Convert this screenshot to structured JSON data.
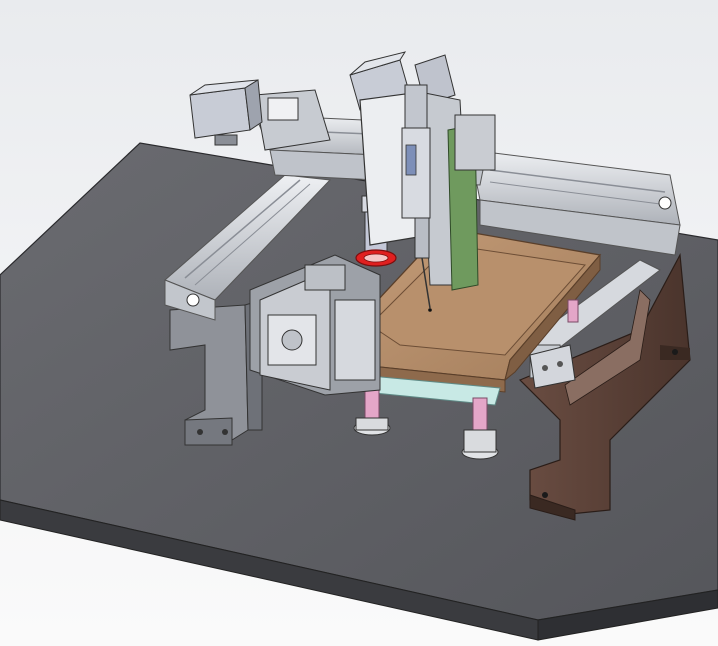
{
  "viewport": {
    "background_top": "#e9ebee",
    "background_bottom": "#fafafa"
  },
  "model": {
    "kind": "CAD assembly render",
    "colors": {
      "base_plate_top": "#5c5d62",
      "base_plate_side": "#3c3c40",
      "frame_metal": "#b9bcc3",
      "rail_aluminum": "#d5d8dd",
      "fixture_tray": "#b58f6b",
      "support_brackets": "#5a4036",
      "highlight_ring": "#e02020",
      "guide_posts": "#e4a6c8",
      "clear_plate": "#bfe3e0",
      "motor_gray": "#c8ccd6"
    }
  }
}
